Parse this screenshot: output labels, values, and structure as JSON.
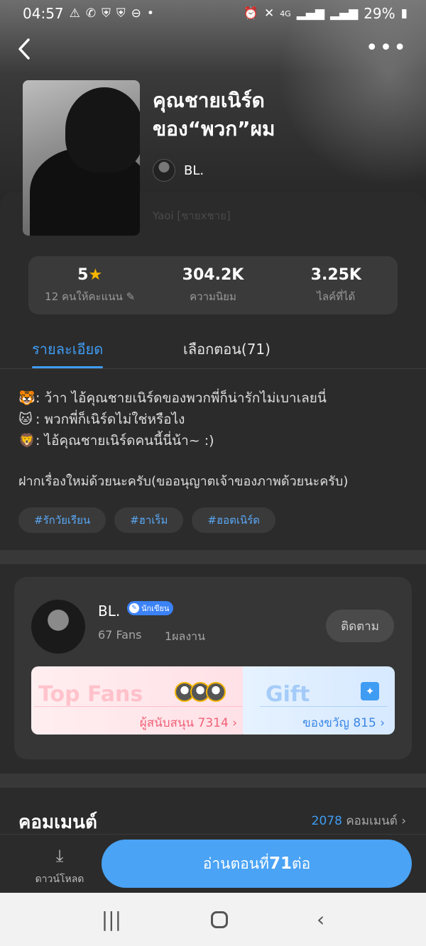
{
  "status_bar": {
    "time": "04:57",
    "battery": "29%",
    "network": "4G"
  },
  "header": {
    "back_icon": "chevron-left-icon",
    "more_icon": "more-dots-icon"
  },
  "book": {
    "title_line1": "คุณชายเนิร์ด",
    "title_line2": "ของ“พวก”ผม",
    "author": "BL.",
    "genre": "Yaoi [ชายxชาย]"
  },
  "stats": {
    "rating": "5",
    "rating_label": "12 คนให้คะแนน",
    "popularity": "304.2K",
    "popularity_label": "ความนิยม",
    "likes": "3.25K",
    "likes_label": "ไลค์ที่ได้"
  },
  "tabs": {
    "details": "รายละเอียด",
    "episodes": "เลือกตอน(71)"
  },
  "description": {
    "lines": [
      {
        "emoji": "🐯",
        "text": ": ว้าา ไอ้คุณชายเนิร์ดของพวกพี่ก็น่ารักไม่เบาเลยนี่"
      },
      {
        "emoji": "🐱",
        "text": ": พวกพี่ก็เนิร์ดไม่ใช่หรือไง"
      },
      {
        "emoji": "🦁",
        "text": ": ไอ้คุณชายเนิร์ดคนนี้นี่น้า~ :)"
      }
    ],
    "note": "ฝากเรื่องใหม่ด้วยนะครับ(ขออนุญาตเจ้าของภาพด้วยนะครับ)"
  },
  "tags": [
    "#รักวัยเรียน",
    "#ฮาเร็ม",
    "#ฮอตเนิร์ด"
  ],
  "author_card": {
    "name": "BL.",
    "badge": "นักเขียน",
    "fans": "67 Fans",
    "works": "1ผลงาน",
    "follow": "ติดตาม",
    "top_fans_title": "Top Fans",
    "top_fans_sub": "ผู้สนับสนุน 7314",
    "gift_title": "Gift",
    "gift_sub": "ของขวัญ 815"
  },
  "comments": {
    "title": "คอมเมนต์",
    "count": "2078",
    "count_label": "คอมเมนต์"
  },
  "bottom": {
    "download": "ดาวน์โหลด",
    "read_prefix": "อ่านตอนที่",
    "read_num": "71",
    "read_suffix": "ต่อ"
  },
  "colors": {
    "accent": "#3f9cf3",
    "background": "#2b2b2b",
    "star": "#f7b500",
    "pink": "#f06278"
  }
}
